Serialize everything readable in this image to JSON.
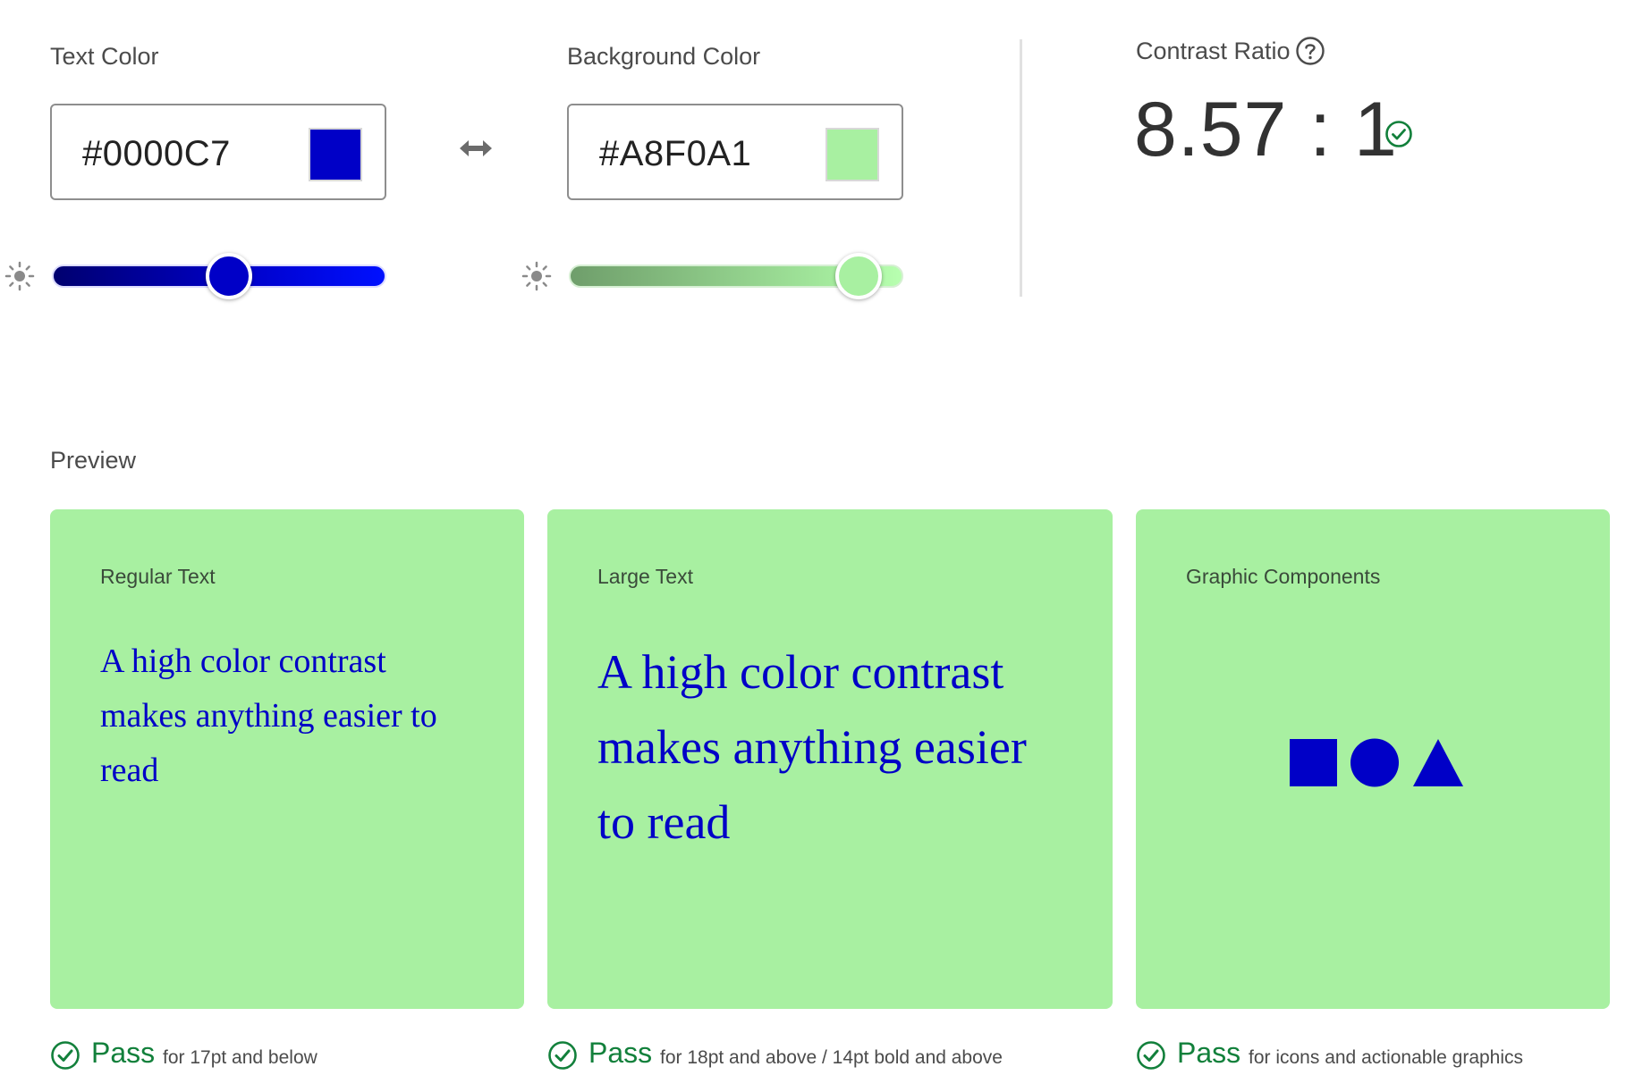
{
  "text_color": {
    "label": "Text Color",
    "hex": "#0000C7",
    "swatch": "#0000C7",
    "lightness_slider_fraction": 0.53
  },
  "swap_icon": "swap-arrows-icon",
  "background_color": {
    "label": "Background Color",
    "hex": "#A8F0A1",
    "swatch": "#A8F0A1",
    "lightness_slider_fraction": 0.9
  },
  "contrast": {
    "label": "Contrast Ratio",
    "help_icon": "question-mark-icon",
    "ratio": "8.57 : 1",
    "status_icon": "check-circle-icon"
  },
  "preview": {
    "label": "Preview",
    "cards": [
      {
        "title": "Regular Text",
        "sample": "A high color contrast makes anything easier to read"
      },
      {
        "title": "Large Text",
        "sample": "A high color contrast makes anything easier to read"
      },
      {
        "title": "Graphic Components",
        "shapes": [
          "square-icon",
          "circle-icon",
          "triangle-icon"
        ]
      }
    ]
  },
  "results": [
    {
      "status": "Pass",
      "description": "for 17pt and below"
    },
    {
      "status": "Pass",
      "description": "for 18pt and above / 14pt bold and above"
    },
    {
      "status": "Pass",
      "description": "for icons and actionable graphics"
    }
  ],
  "colors": {
    "pass_green": "#12803B",
    "divider": "#E1E1E1"
  }
}
